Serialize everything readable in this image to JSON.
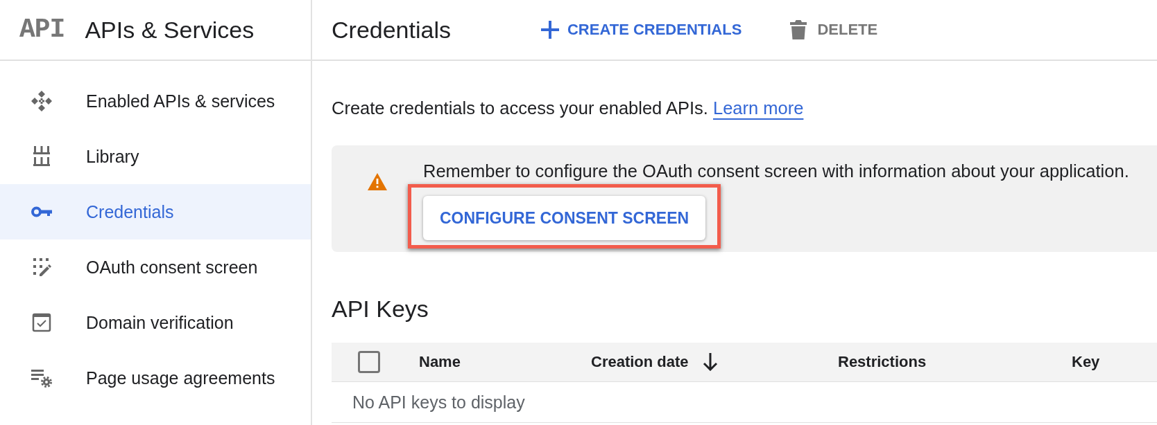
{
  "app": {
    "logo": "API",
    "title": "APIs & Services"
  },
  "sidebar": {
    "items": [
      {
        "label": "Enabled APIs & services",
        "selected": false
      },
      {
        "label": "Library",
        "selected": false
      },
      {
        "label": "Credentials",
        "selected": true
      },
      {
        "label": "OAuth consent screen",
        "selected": false
      },
      {
        "label": "Domain verification",
        "selected": false
      },
      {
        "label": "Page usage agreements",
        "selected": false
      }
    ]
  },
  "header": {
    "title": "Credentials",
    "actions": [
      {
        "label": "CREATE CREDENTIALS",
        "disabled": false
      },
      {
        "label": "DELETE",
        "disabled": true
      }
    ]
  },
  "intro": {
    "text": "Create credentials to access your enabled APIs.",
    "link": "Learn more"
  },
  "notice": {
    "text": "Remember to configure the OAuth consent screen with information about your application.",
    "button": {
      "label": "CONFIGURE CONSENT SCREEN",
      "highlighted": true
    }
  },
  "api_keys": {
    "title": "API Keys",
    "select_all": {
      "checked": false
    },
    "columns": [
      {
        "label": "Name",
        "sorted": false
      },
      {
        "label": "Creation date",
        "sorted": true
      },
      {
        "label": "Restrictions",
        "sorted": false
      },
      {
        "label": "Key",
        "sorted": false
      }
    ],
    "empty_text": "No API keys to display"
  }
}
